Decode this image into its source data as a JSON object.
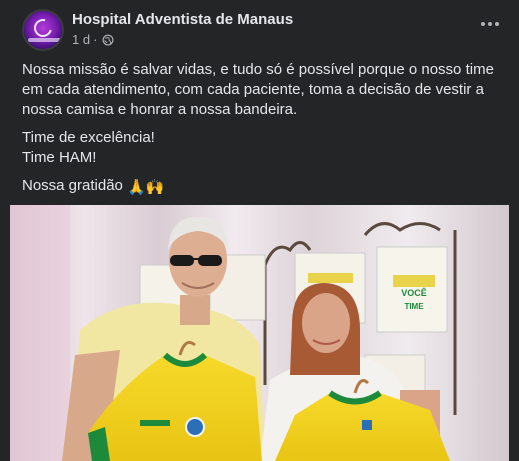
{
  "post": {
    "page_name": "Hospital Adventista de Manaus",
    "time": "1 d",
    "separator": "·",
    "privacy_icon": "globe-icon",
    "more_icon": "more-options-icon"
  },
  "body": {
    "paragraph1": "Nossa missão é salvar vidas, e tudo só é possível porque o nosso time em cada atendimento, com cada paciente, toma a decisão de vestir a nossa camisa e honrar a nossa bandeira.",
    "line_team1": "Time de excelência!",
    "line_team2": "Time HAM!",
    "gratitude": "Nossa gratidão",
    "gratitude_emojis": "🙏🙌"
  },
  "photo": {
    "banner_text_1": "VOCÊ",
    "banner_text_2": "TIME"
  },
  "colors": {
    "background": "#242526",
    "text": "#e4e6eb",
    "secondary_text": "#b0b3b8",
    "jersey_yellow": "#f2cf1d",
    "jersey_green": "#1c8a3a"
  }
}
